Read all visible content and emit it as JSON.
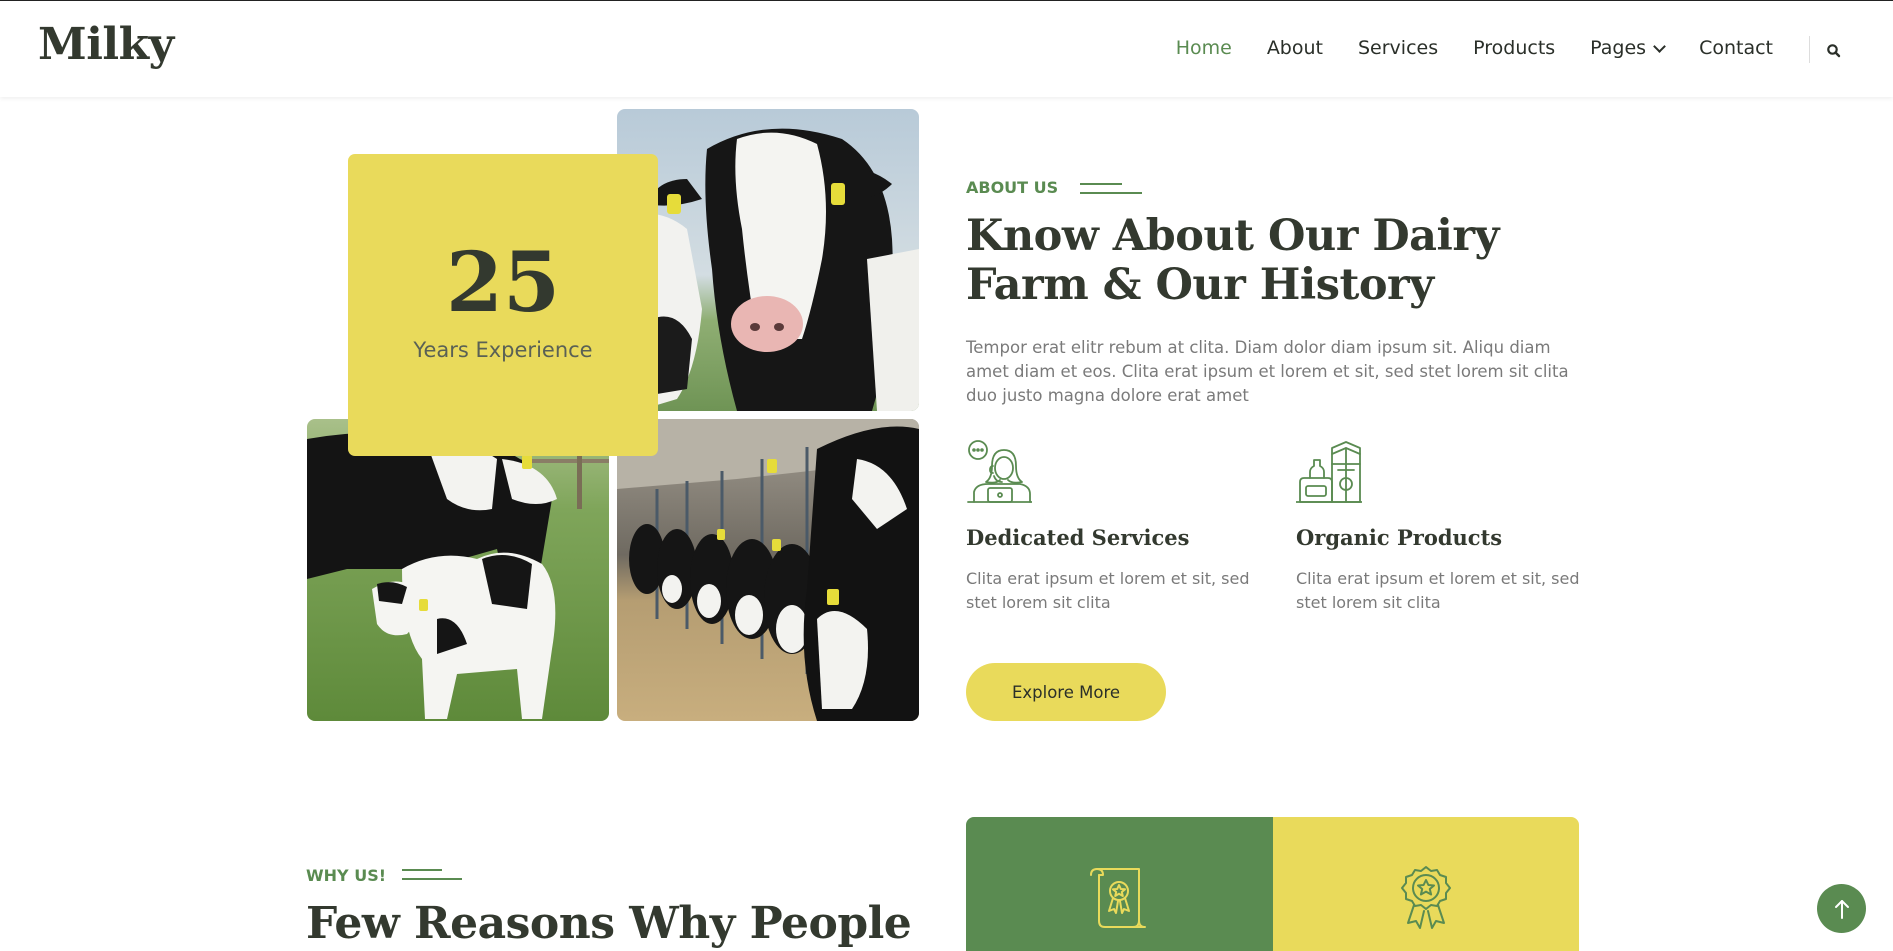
{
  "nav": {
    "brand": "Milky",
    "links": [
      "Home",
      "About",
      "Services",
      "Products",
      "Pages",
      "Contact"
    ],
    "active": "Home",
    "search_icon": "search-icon"
  },
  "experience": {
    "number": "25",
    "label": "Years Experience"
  },
  "images": [
    "cow-closeup",
    "cow-with-calf",
    "cows-feeding-barn"
  ],
  "about": {
    "eyebrow": "ABOUT US",
    "title": "Know About Our Dairy Farm & Our History",
    "description": "Tempor erat elitr rebum at clita. Diam dolor diam ipsum sit. Aliqu diam amet diam et eos. Clita erat ipsum et lorem et sit, sed stet lorem sit clita duo justo magna dolore erat amet",
    "features": [
      {
        "icon": "support-agent-icon",
        "title": "Dedicated Services",
        "text": "Clita erat ipsum et lorem et sit, sed stet lorem sit clita"
      },
      {
        "icon": "dairy-products-icon",
        "title": "Organic Products",
        "text": "Clita erat ipsum et lorem et sit, sed stet lorem sit clita"
      }
    ],
    "button": "Explore More"
  },
  "why": {
    "eyebrow": "WHY US!",
    "title": "Few Reasons Why People",
    "cards": [
      {
        "icon": "certificate-icon",
        "color": "#5a8b51"
      },
      {
        "icon": "award-badge-icon",
        "color": "#e9da5b"
      }
    ]
  },
  "colors": {
    "green": "#5a8b51",
    "yellow": "#e9da5b",
    "dark": "#33392f",
    "text_muted": "#7a7a7a"
  },
  "back_to_top_icon": "arrow-up-icon"
}
